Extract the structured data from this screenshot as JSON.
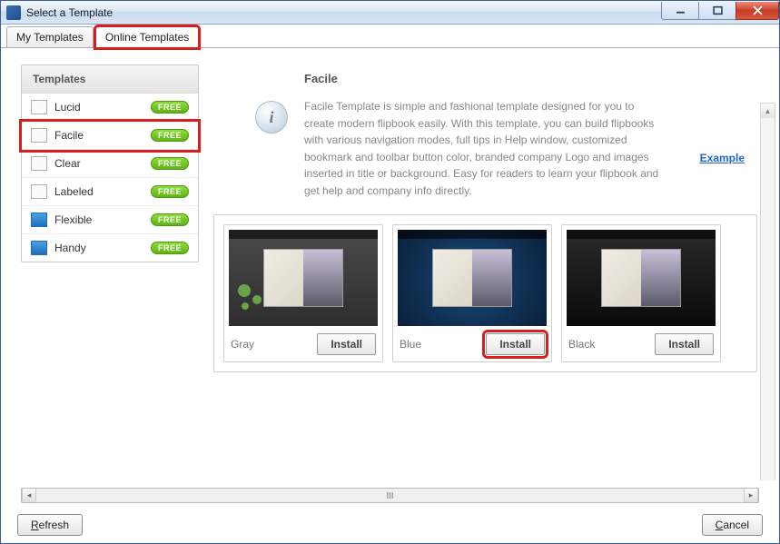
{
  "window": {
    "title": "Select a Template"
  },
  "tabs": {
    "my_templates": "My Templates",
    "online_templates": "Online Templates"
  },
  "sidebar": {
    "header": "Templates",
    "items": [
      {
        "label": "Lucid",
        "badge": "FREE"
      },
      {
        "label": "Facile",
        "badge": "FREE"
      },
      {
        "label": "Clear",
        "badge": "FREE"
      },
      {
        "label": "Labeled",
        "badge": "FREE"
      },
      {
        "label": "Flexible",
        "badge": "FREE"
      },
      {
        "label": "Handy",
        "badge": "FREE"
      }
    ]
  },
  "detail": {
    "title": "Facile",
    "description": "Facile Template is simple and fashional template designed for you to create modern flipbook easily. With this template, you can build flipbooks with various navigation modes, full tips in Help window, customized bookmark and toolbar button color, branded company Logo and images inserted in title or background. Easy for readers to learn your flipbook and get help and company info directly.",
    "example_link": "Example"
  },
  "cards": [
    {
      "label": "Gray",
      "button": "Install"
    },
    {
      "label": "Blue",
      "button": "Install"
    },
    {
      "label": "Black",
      "button": "Install"
    }
  ],
  "footer": {
    "refresh": "Refresh",
    "cancel": "Cancel"
  }
}
